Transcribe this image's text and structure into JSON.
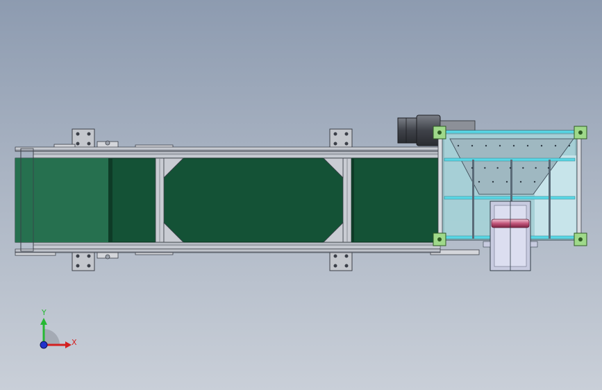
{
  "scene": {
    "description_free": true,
    "colors": {
      "background_top": "#8d9bb0",
      "background_bottom": "#c9cfd8",
      "belt": "#145236",
      "belt_light": "#26704f",
      "frame": "#c9ccd3",
      "frame_dark": "#3b3f48",
      "hopper_glass": "#7fb2b8",
      "hopper_cyan": "#5ad8e6",
      "corner_plate": "#9fd98a",
      "motor": "#55585f",
      "roller_red": "#c2557a"
    },
    "icons": {
      "coordinate_triad": "axis-triad-icon",
      "motor": "gear-motor-icon"
    }
  },
  "triad": {
    "x_label": "X",
    "y_label": "Y"
  }
}
